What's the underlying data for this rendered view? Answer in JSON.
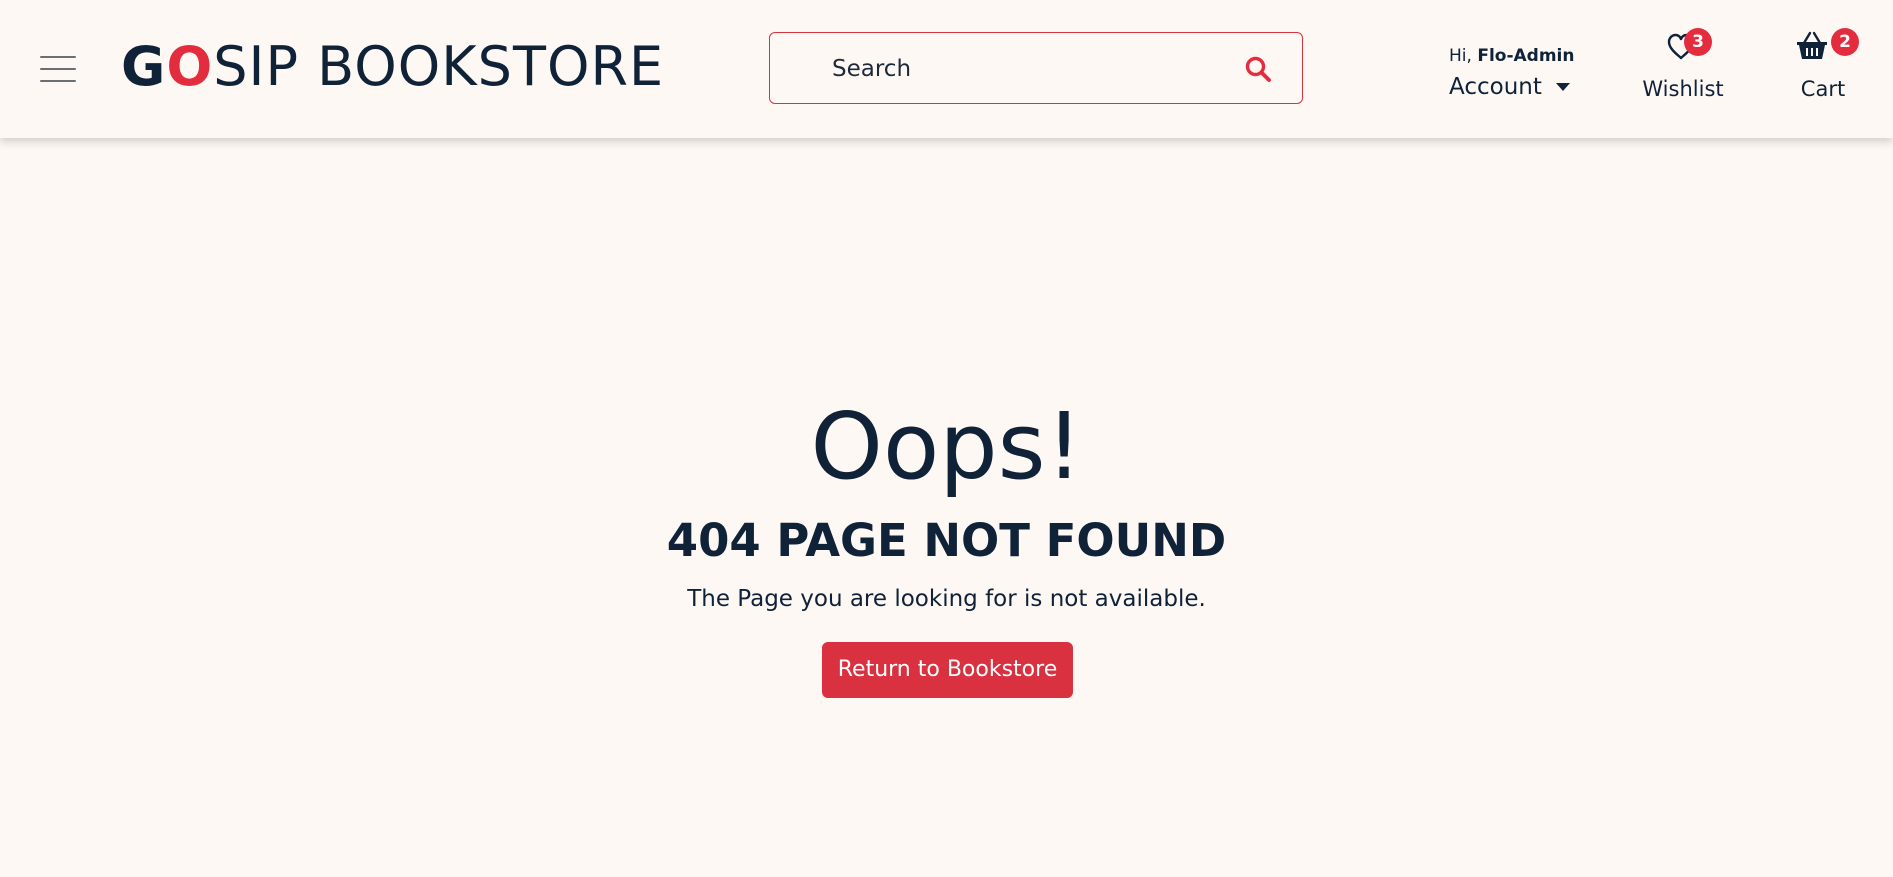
{
  "header": {
    "logo": {
      "part_g": "G",
      "part_o": "O",
      "part_sip": "SIP BOOKSTORE"
    },
    "search": {
      "placeholder": "Search",
      "value": ""
    },
    "account": {
      "greeting_prefix": "Hi,",
      "username": "Flo-Admin",
      "label": "Account"
    },
    "wishlist": {
      "label": "Wishlist",
      "count": "3"
    },
    "cart": {
      "label": "Cart",
      "count": "2"
    }
  },
  "error_page": {
    "headline": "Oops!",
    "title": "404 PAGE NOT FOUND",
    "message": "The Page you are looking for is not available.",
    "button_label": "Return to Bookstore"
  },
  "colors": {
    "brand_red": "#e32d3e",
    "navy": "#0f2238",
    "background": "#fef8f4"
  },
  "icons": {
    "menu": "hamburger-menu-icon",
    "search": "magnifier-search-icon",
    "account_dropdown": "caret-down-icon",
    "wishlist": "heart-outline-icon",
    "cart": "shopping-basket-icon"
  }
}
